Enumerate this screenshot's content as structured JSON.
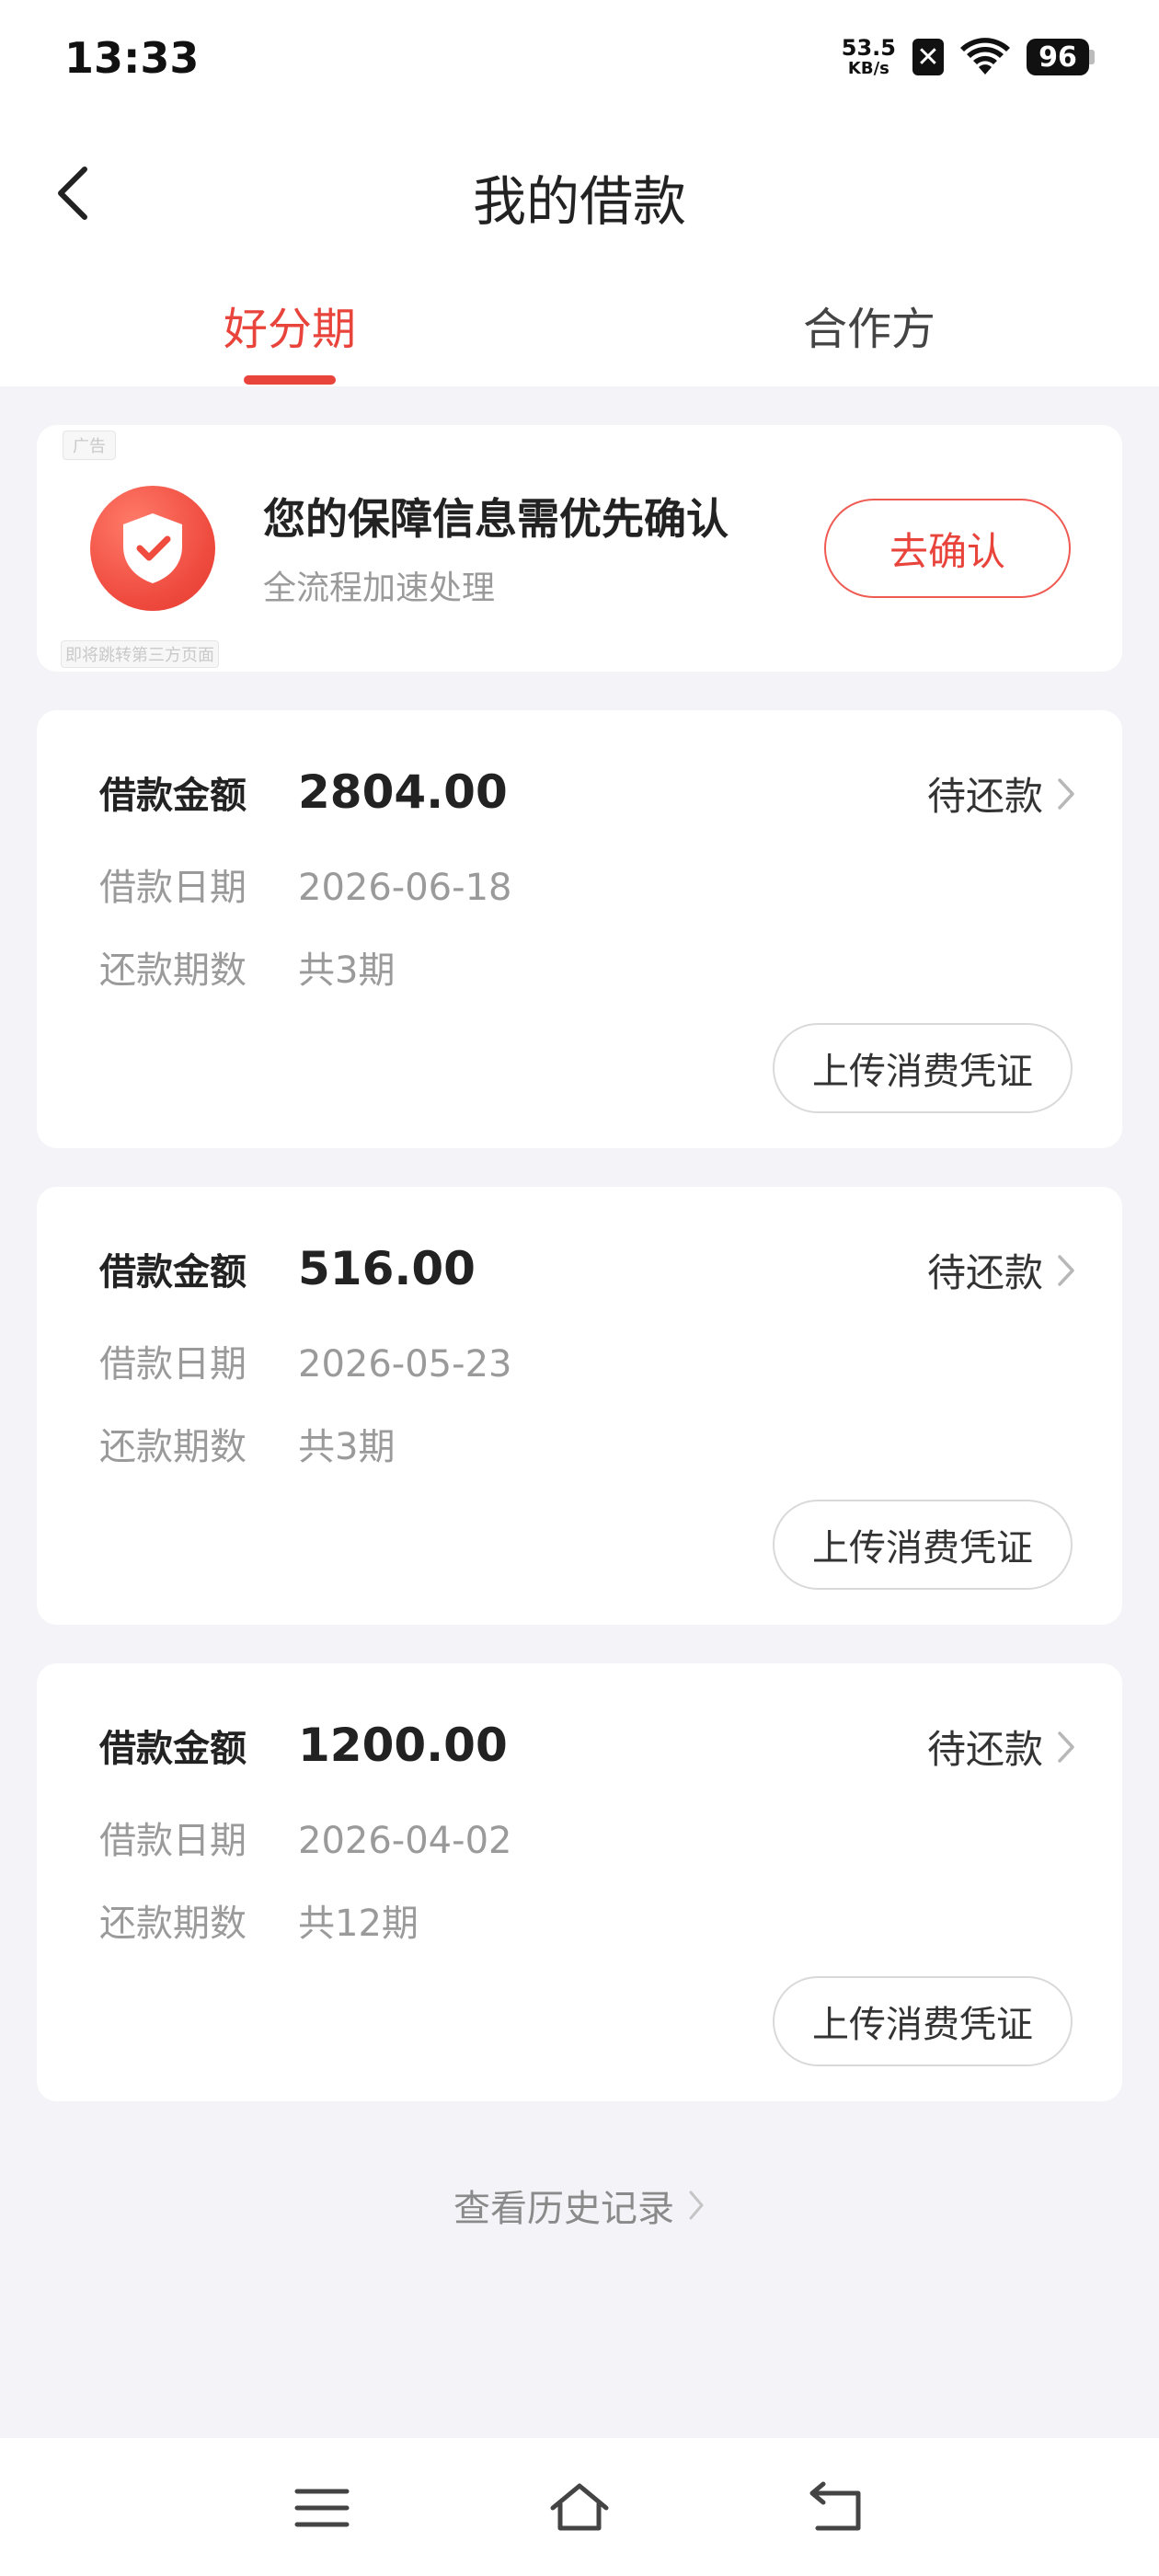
{
  "status_bar": {
    "time": "13:33",
    "net_speed_value": "53.5",
    "net_speed_unit": "KB/s",
    "x_badge": "✕",
    "battery": "96"
  },
  "header": {
    "title": "我的借款"
  },
  "tabs": [
    {
      "label": "好分期",
      "active": true
    },
    {
      "label": "合作方",
      "active": false
    }
  ],
  "ad": {
    "tag": "广告",
    "title": "您的保障信息需优先确认",
    "subtitle": "全流程加速处理",
    "button": "去确认",
    "note": "即将跳转第三方页面"
  },
  "loan_labels": {
    "amount": "借款金额",
    "date": "借款日期",
    "periods": "还款期数"
  },
  "loans": [
    {
      "amount": "2804.00",
      "date": "2026-06-18",
      "periods": "共3期",
      "status": "待还款",
      "upload": "上传消费凭证"
    },
    {
      "amount": "516.00",
      "date": "2026-05-23",
      "periods": "共3期",
      "status": "待还款",
      "upload": "上传消费凭证"
    },
    {
      "amount": "1200.00",
      "date": "2026-04-02",
      "periods": "共12期",
      "status": "待还款",
      "upload": "上传消费凭证"
    }
  ],
  "history": {
    "label": "查看历史记录"
  },
  "colors": {
    "accent": "#e9443c",
    "background": "#f4f4f8"
  }
}
